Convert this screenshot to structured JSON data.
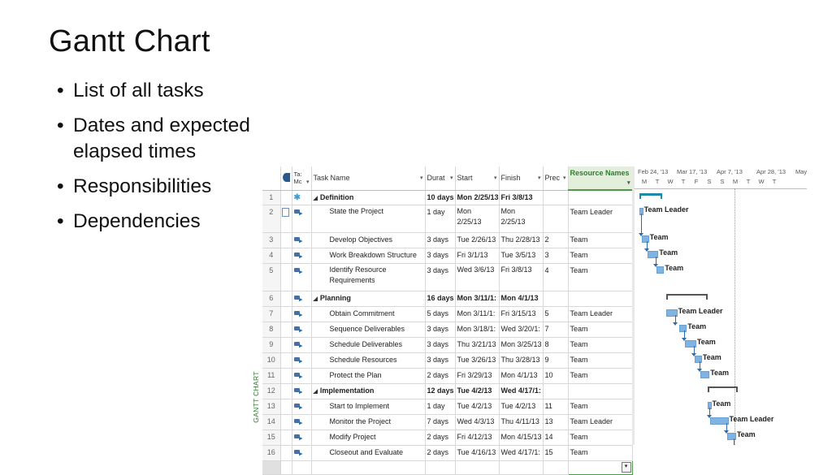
{
  "slide": {
    "title": "Gantt Chart",
    "bullets": [
      "List of all tasks",
      "Dates and expected elapsed times",
      "Responsibilities",
      "Dependencies"
    ],
    "bullet_char": "•"
  },
  "project": {
    "side_label": "GANTT CHART",
    "columns": {
      "mode": "Ta: Mc",
      "task_name": "Task Name",
      "duration": "Durat",
      "start": "Start",
      "finish": "Finish",
      "pred": "Prec",
      "resources": "Resource Names"
    },
    "rows": [
      {
        "id": "1",
        "task": "Definition",
        "dur": "10 days",
        "start": "Mon 2/25/13",
        "finish": "Fri 3/8/13",
        "pred": "",
        "res": "",
        "summary": true,
        "mode": "pin"
      },
      {
        "id": "2",
        "task": "State the Project",
        "dur": "1 day",
        "start": "Mon 2/25/13",
        "finish": "Mon 2/25/13",
        "pred": "",
        "res": "Team Leader",
        "summary": false,
        "mode": "auto",
        "note": true
      },
      {
        "id": "3",
        "task": "Develop Objectives",
        "dur": "3 days",
        "start": "Tue 2/26/13",
        "finish": "Thu 2/28/13",
        "pred": "2",
        "res": "Team",
        "summary": false,
        "mode": "auto"
      },
      {
        "id": "4",
        "task": "Work Breakdown Structure",
        "dur": "3 days",
        "start": "Fri 3/1/13",
        "finish": "Tue 3/5/13",
        "pred": "3",
        "res": "Team",
        "summary": false,
        "mode": "auto"
      },
      {
        "id": "5",
        "task": "Identify Resource Requirements",
        "dur": "3 days",
        "start": "Wed 3/6/13",
        "finish": "Fri 3/8/13",
        "pred": "4",
        "res": "Team",
        "summary": false,
        "mode": "auto"
      },
      {
        "id": "6",
        "task": "Planning",
        "dur": "16 days",
        "start": "Mon 3/11/1:",
        "finish": "Mon 4/1/13",
        "pred": "",
        "res": "",
        "summary": true,
        "mode": "auto"
      },
      {
        "id": "7",
        "task": "Obtain Commitment",
        "dur": "5 days",
        "start": "Mon 3/11/1:",
        "finish": "Fri 3/15/13",
        "pred": "5",
        "res": "Team Leader",
        "summary": false,
        "mode": "auto"
      },
      {
        "id": "8",
        "task": "Sequence Deliverables",
        "dur": "3 days",
        "start": "Mon 3/18/1:",
        "finish": "Wed 3/20/1:",
        "pred": "7",
        "res": "Team",
        "summary": false,
        "mode": "auto"
      },
      {
        "id": "9",
        "task": "Schedule Deliverables",
        "dur": "3 days",
        "start": "Thu 3/21/13",
        "finish": "Mon 3/25/13",
        "pred": "8",
        "res": "Team",
        "summary": false,
        "mode": "auto"
      },
      {
        "id": "10",
        "task": "Schedule Resources",
        "dur": "3 days",
        "start": "Tue 3/26/13",
        "finish": "Thu 3/28/13",
        "pred": "9",
        "res": "Team",
        "summary": false,
        "mode": "auto"
      },
      {
        "id": "11",
        "task": "Protect the Plan",
        "dur": "2 days",
        "start": "Fri 3/29/13",
        "finish": "Mon 4/1/13",
        "pred": "10",
        "res": "Team",
        "summary": false,
        "mode": "auto"
      },
      {
        "id": "12",
        "task": "Implementation",
        "dur": "12 days",
        "start": "Tue 4/2/13",
        "finish": "Wed 4/17/1:",
        "pred": "",
        "res": "",
        "summary": true,
        "mode": "auto"
      },
      {
        "id": "13",
        "task": "Start to Implement",
        "dur": "1 day",
        "start": "Tue 4/2/13",
        "finish": "Tue 4/2/13",
        "pred": "11",
        "res": "Team",
        "summary": false,
        "mode": "auto"
      },
      {
        "id": "14",
        "task": "Monitor the Project",
        "dur": "7 days",
        "start": "Wed 4/3/13",
        "finish": "Thu 4/11/13",
        "pred": "13",
        "res": "Team Leader",
        "summary": false,
        "mode": "auto"
      },
      {
        "id": "15",
        "task": "Modify Project",
        "dur": "2 days",
        "start": "Fri 4/12/13",
        "finish": "Mon 4/15/13",
        "pred": "14",
        "res": "Team",
        "summary": false,
        "mode": "auto"
      },
      {
        "id": "16",
        "task": "Closeout and Evaluate",
        "dur": "2 days",
        "start": "Tue 4/16/13",
        "finish": "Wed 4/17/1:",
        "pred": "15",
        "res": "Team",
        "summary": false,
        "mode": "auto"
      }
    ],
    "timescale": {
      "top": [
        "Feb 24, '13",
        "Mar 17, '13",
        "Apr 7, '13",
        "Apr 28, '13",
        "May"
      ],
      "bottom": [
        "M",
        "T",
        "W",
        "T",
        "F",
        "S",
        "S",
        "M",
        "T",
        "W",
        "T"
      ]
    },
    "colors": {
      "bar": "#7fb3e3",
      "link": "#2e6ab0",
      "summary_active": "#1c8aa8",
      "resource_header": "#2e7d32"
    }
  }
}
